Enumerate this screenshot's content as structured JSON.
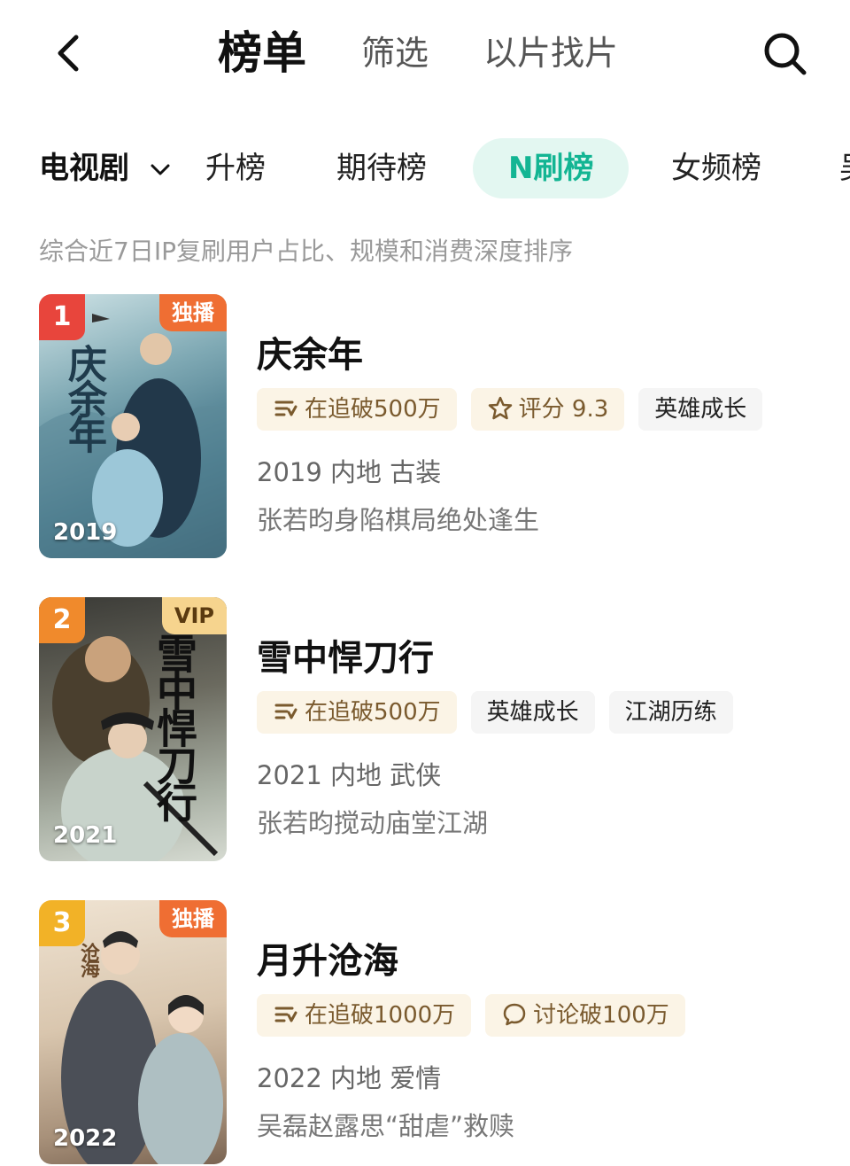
{
  "header": {
    "tabs": [
      "榜单",
      "筛选",
      "以片找片"
    ],
    "back_icon": "back-arrow-icon",
    "search_icon": "search-icon"
  },
  "category_bar": {
    "selector_label": "电视剧",
    "tabs": [
      "升榜",
      "期待榜",
      "N刷榜",
      "女频榜",
      "吴"
    ],
    "active_tab": "N刷榜",
    "accent_color": "#13b593"
  },
  "subtitle": "综合近7日IP复刷用户占比、规模和消费深度排序",
  "items": [
    {
      "rank": "1",
      "rank_color": "#e8453c",
      "badge": "独播",
      "poster_year": "2019",
      "poster_title": "庆余年",
      "title": "庆余年",
      "tags": [
        {
          "icon": "follow-icon",
          "text": "在追破500万"
        },
        {
          "icon": "star-icon",
          "text": "评分 9.3"
        },
        {
          "text": "英雄成长"
        }
      ],
      "meta": "2019 内地 古装",
      "desc": "张若昀身陷棋局绝处逢生"
    },
    {
      "rank": "2",
      "rank_color": "#f08a2c",
      "badge": "VIP",
      "poster_year": "2021",
      "poster_title": "雪中悍刀行",
      "title": "雪中悍刀行",
      "tags": [
        {
          "icon": "follow-icon",
          "text": "在追破500万"
        },
        {
          "text": "英雄成长"
        },
        {
          "text": "江湖历练"
        }
      ],
      "meta": "2021 内地 武侠",
      "desc": "张若昀搅动庙堂江湖"
    },
    {
      "rank": "3",
      "rank_color": "#f2b227",
      "badge": "独播",
      "poster_year": "2022",
      "poster_title": "沧海",
      "title": "月升沧海",
      "tags": [
        {
          "icon": "follow-icon",
          "text": "在追破1000万"
        },
        {
          "icon": "comment-icon",
          "text": "讨论破100万"
        }
      ],
      "meta": "2022 内地 爱情",
      "desc": "吴磊赵露思“甜虐”救赎"
    }
  ]
}
